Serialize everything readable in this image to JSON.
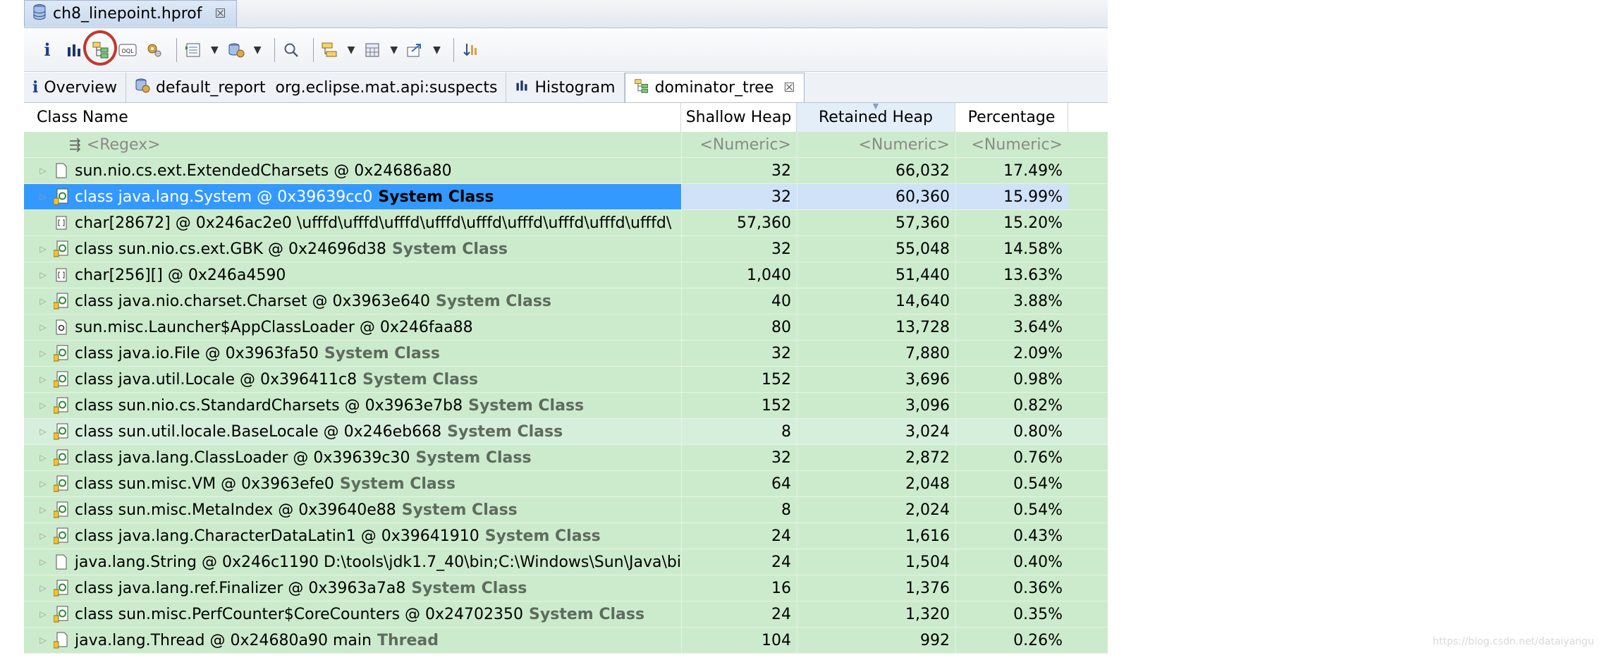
{
  "editor_tab": {
    "title": "ch8_linepoint.hprof",
    "close": "☒"
  },
  "view_tabs": [
    {
      "label": "Overview"
    },
    {
      "label": "default_report  org.eclipse.mat.api:suspects"
    },
    {
      "label": "Histogram"
    },
    {
      "label": "dominator_tree",
      "close": "☒"
    }
  ],
  "columns": {
    "name": "Class Name",
    "shallow": "Shallow Heap",
    "retained": "Retained Heap",
    "percentage": "Percentage"
  },
  "filter_row": {
    "name": "<Regex>",
    "shallow": "<Numeric>",
    "retained": "<Numeric>",
    "percentage": "<Numeric>"
  },
  "rows": [
    {
      "name": "sun.nio.cs.ext.ExtendedCharsets @ 0x24686a80",
      "tag": "",
      "icon": "object-icon",
      "shallow": "32",
      "retained": "66,032",
      "percentage": "17.49%"
    },
    {
      "name": "class java.lang.System @ 0x39639cc0",
      "tag": "System Class",
      "icon": "class-icon",
      "shallow": "32",
      "retained": "60,360",
      "percentage": "15.99%"
    },
    {
      "name": "char[28672] @ 0x246ac2e0  \\ufffd\\ufffd\\ufffd\\ufffd\\ufffd\\ufffd\\ufffd\\ufffd\\ufffd\\",
      "tag": "",
      "icon": "array-icon",
      "shallow": "57,360",
      "retained": "57,360",
      "percentage": "15.20%"
    },
    {
      "name": "class sun.nio.cs.ext.GBK @ 0x24696d38",
      "tag": "System Class",
      "icon": "class-icon",
      "shallow": "32",
      "retained": "55,048",
      "percentage": "14.58%"
    },
    {
      "name": "char[256][] @ 0x246a4590",
      "tag": "",
      "icon": "array-icon",
      "shallow": "1,040",
      "retained": "51,440",
      "percentage": "13.63%"
    },
    {
      "name": "class java.nio.charset.Charset @ 0x3963e640",
      "tag": "System Class",
      "icon": "class-icon",
      "shallow": "40",
      "retained": "14,640",
      "percentage": "3.88%"
    },
    {
      "name": "sun.misc.Launcher$AppClassLoader @ 0x246faa88",
      "tag": "",
      "icon": "classloader-icon",
      "shallow": "80",
      "retained": "13,728",
      "percentage": "3.64%"
    },
    {
      "name": "class java.io.File @ 0x3963fa50",
      "tag": "System Class",
      "icon": "class-icon",
      "shallow": "32",
      "retained": "7,880",
      "percentage": "2.09%"
    },
    {
      "name": "class java.util.Locale @ 0x396411c8",
      "tag": "System Class",
      "icon": "class-icon",
      "shallow": "152",
      "retained": "3,696",
      "percentage": "0.98%"
    },
    {
      "name": "class sun.nio.cs.StandardCharsets @ 0x3963e7b8",
      "tag": "System Class",
      "icon": "class-icon",
      "shallow": "152",
      "retained": "3,096",
      "percentage": "0.82%"
    },
    {
      "name": "class sun.util.locale.BaseLocale @ 0x246eb668",
      "tag": "System Class",
      "icon": "class-icon",
      "shallow": "8",
      "retained": "3,024",
      "percentage": "0.80%"
    },
    {
      "name": "class java.lang.ClassLoader @ 0x39639c30",
      "tag": "System Class",
      "icon": "class-icon",
      "shallow": "32",
      "retained": "2,872",
      "percentage": "0.76%"
    },
    {
      "name": "class sun.misc.VM @ 0x3963efe0",
      "tag": "System Class",
      "icon": "class-icon",
      "shallow": "64",
      "retained": "2,048",
      "percentage": "0.54%"
    },
    {
      "name": "class sun.misc.MetaIndex @ 0x39640e88",
      "tag": "System Class",
      "icon": "class-icon",
      "shallow": "8",
      "retained": "2,024",
      "percentage": "0.54%"
    },
    {
      "name": "class java.lang.CharacterDataLatin1 @ 0x39641910",
      "tag": "System Class",
      "icon": "class-icon",
      "shallow": "24",
      "retained": "1,616",
      "percentage": "0.43%"
    },
    {
      "name": "java.lang.String @ 0x246c1190  D:\\tools\\jdk1.7_40\\bin;C:\\Windows\\Sun\\Java\\bi",
      "tag": "",
      "icon": "object-icon",
      "shallow": "24",
      "retained": "1,504",
      "percentage": "0.40%"
    },
    {
      "name": "class java.lang.ref.Finalizer @ 0x3963a7a8",
      "tag": "System Class",
      "icon": "class-icon",
      "shallow": "16",
      "retained": "1,376",
      "percentage": "0.36%"
    },
    {
      "name": "class sun.misc.PerfCounter$CoreCounters @ 0x24702350",
      "tag": "System Class",
      "icon": "class-icon",
      "shallow": "24",
      "retained": "1,320",
      "percentage": "0.35%"
    },
    {
      "name": "java.lang.Thread @ 0x24680a90  main",
      "tag": "Thread",
      "icon": "thread-icon",
      "shallow": "104",
      "retained": "992",
      "percentage": "0.26%"
    }
  ],
  "selected_row": 1,
  "hover_row": 10,
  "watermark": "https://blog.csdn.net/dataiyangu"
}
